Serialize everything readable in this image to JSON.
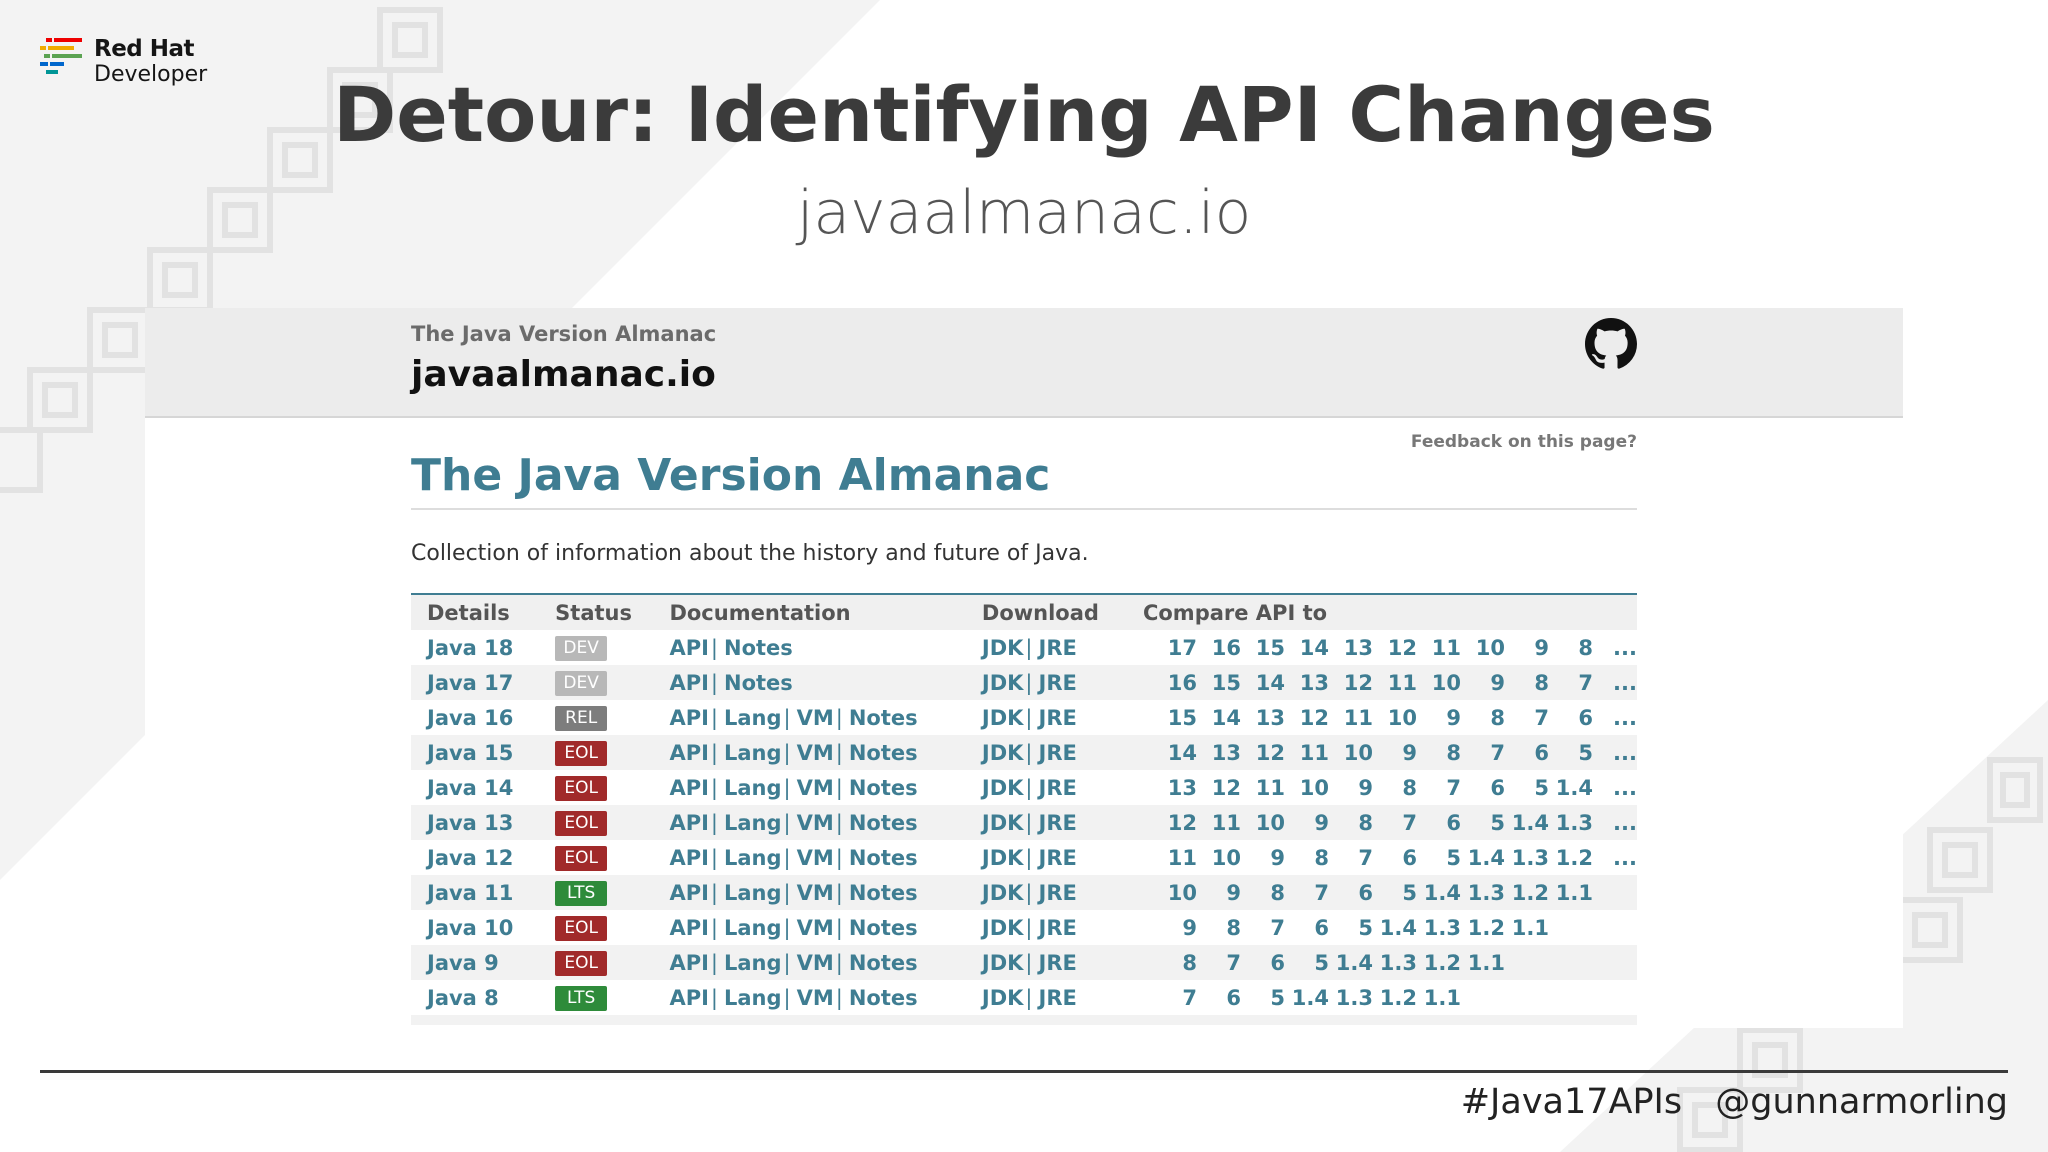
{
  "logo": {
    "brand": "Red Hat",
    "product": "Developer"
  },
  "slide": {
    "title": "Detour: Identifying API Changes",
    "subtitle": "javaalmanac.io"
  },
  "site": {
    "kicker": "The Java Version Almanac",
    "name": "javaalmanac.io",
    "github_icon": "github-icon",
    "feedback_link": "Feedback on this page?",
    "heading": "The Java Version Almanac",
    "tagline": "Collection of information about the history and future of Java."
  },
  "table": {
    "headers": [
      "Details",
      "Status",
      "Documentation",
      "Download",
      "Compare API to"
    ],
    "status_colors": {
      "DEV": "#b8b8b8",
      "REL": "#7d7d7d",
      "EOL": "#a12a2a",
      "LTS": "#2e8b3a"
    },
    "rows": [
      {
        "version": "Java 18",
        "status": "DEV",
        "docs": [
          "API",
          "Notes"
        ],
        "downloads": [
          "JDK",
          "JRE"
        ],
        "compare": [
          "17",
          "16",
          "15",
          "14",
          "13",
          "12",
          "11",
          "10",
          "9",
          "8",
          "..."
        ]
      },
      {
        "version": "Java 17",
        "status": "DEV",
        "docs": [
          "API",
          "Notes"
        ],
        "downloads": [
          "JDK",
          "JRE"
        ],
        "compare": [
          "16",
          "15",
          "14",
          "13",
          "12",
          "11",
          "10",
          "9",
          "8",
          "7",
          "..."
        ]
      },
      {
        "version": "Java 16",
        "status": "REL",
        "docs": [
          "API",
          "Lang",
          "VM",
          "Notes"
        ],
        "downloads": [
          "JDK",
          "JRE"
        ],
        "compare": [
          "15",
          "14",
          "13",
          "12",
          "11",
          "10",
          "9",
          "8",
          "7",
          "6",
          "..."
        ]
      },
      {
        "version": "Java 15",
        "status": "EOL",
        "docs": [
          "API",
          "Lang",
          "VM",
          "Notes"
        ],
        "downloads": [
          "JDK",
          "JRE"
        ],
        "compare": [
          "14",
          "13",
          "12",
          "11",
          "10",
          "9",
          "8",
          "7",
          "6",
          "5",
          "..."
        ]
      },
      {
        "version": "Java 14",
        "status": "EOL",
        "docs": [
          "API",
          "Lang",
          "VM",
          "Notes"
        ],
        "downloads": [
          "JDK",
          "JRE"
        ],
        "compare": [
          "13",
          "12",
          "11",
          "10",
          "9",
          "8",
          "7",
          "6",
          "5",
          "1.4",
          "..."
        ]
      },
      {
        "version": "Java 13",
        "status": "EOL",
        "docs": [
          "API",
          "Lang",
          "VM",
          "Notes"
        ],
        "downloads": [
          "JDK",
          "JRE"
        ],
        "compare": [
          "12",
          "11",
          "10",
          "9",
          "8",
          "7",
          "6",
          "5",
          "1.4",
          "1.3",
          "..."
        ]
      },
      {
        "version": "Java 12",
        "status": "EOL",
        "docs": [
          "API",
          "Lang",
          "VM",
          "Notes"
        ],
        "downloads": [
          "JDK",
          "JRE"
        ],
        "compare": [
          "11",
          "10",
          "9",
          "8",
          "7",
          "6",
          "5",
          "1.4",
          "1.3",
          "1.2",
          "..."
        ]
      },
      {
        "version": "Java 11",
        "status": "LTS",
        "docs": [
          "API",
          "Lang",
          "VM",
          "Notes"
        ],
        "downloads": [
          "JDK",
          "JRE"
        ],
        "compare": [
          "10",
          "9",
          "8",
          "7",
          "6",
          "5",
          "1.4",
          "1.3",
          "1.2",
          "1.1"
        ]
      },
      {
        "version": "Java 10",
        "status": "EOL",
        "docs": [
          "API",
          "Lang",
          "VM",
          "Notes"
        ],
        "downloads": [
          "JDK",
          "JRE"
        ],
        "compare": [
          "9",
          "8",
          "7",
          "6",
          "5",
          "1.4",
          "1.3",
          "1.2",
          "1.1"
        ]
      },
      {
        "version": "Java 9",
        "status": "EOL",
        "docs": [
          "API",
          "Lang",
          "VM",
          "Notes"
        ],
        "downloads": [
          "JDK",
          "JRE"
        ],
        "compare": [
          "8",
          "7",
          "6",
          "5",
          "1.4",
          "1.3",
          "1.2",
          "1.1"
        ]
      },
      {
        "version": "Java 8",
        "status": "LTS",
        "docs": [
          "API",
          "Lang",
          "VM",
          "Notes"
        ],
        "downloads": [
          "JDK",
          "JRE"
        ],
        "compare": [
          "7",
          "6",
          "5",
          "1.4",
          "1.3",
          "1.2",
          "1.1"
        ]
      }
    ]
  },
  "footer": {
    "hashtag": "#Java17APIs",
    "handle": "@gunnarmorling"
  }
}
